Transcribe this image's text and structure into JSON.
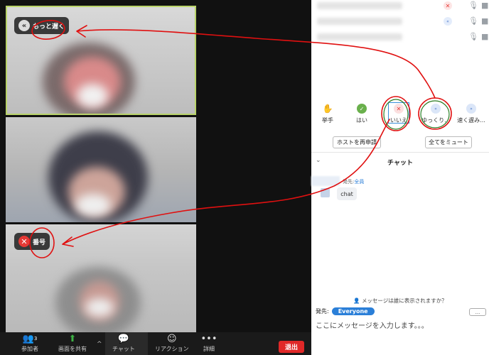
{
  "videos": {
    "tile1_badge": {
      "icon": "double-chevron-left-icon",
      "label": "もっと遅く"
    },
    "tile3_badge": {
      "icon": "close-icon",
      "label": "番号"
    }
  },
  "toolbar": {
    "participants": {
      "label": "参加者",
      "count": "3"
    },
    "share": {
      "label": "画面を共有"
    },
    "chat": {
      "label": "チャット"
    },
    "reaction": {
      "label": "リアクション"
    },
    "more": {
      "label": "詳細"
    },
    "end": {
      "label": "退出"
    }
  },
  "reactions": [
    {
      "label": "挙手",
      "icon": "hand-icon"
    },
    {
      "label": "はい",
      "icon": "check-icon"
    },
    {
      "label": "いいえ",
      "icon": "close-icon"
    },
    {
      "label": "ゆっくり...",
      "icon": "slow-icon"
    },
    {
      "label": "速く遅み...",
      "icon": "fast-icon"
    }
  ],
  "host_buttons": {
    "unmute_request": "ホストを再申請",
    "mute_all": "全てをミュート"
  },
  "chat": {
    "title": "チャット",
    "message": {
      "to_prefix": "発先:",
      "to_target": "全員",
      "text": "chat"
    },
    "who_sees": "メッセージは誰に表示されますか？",
    "to_label": "発先:",
    "to_value": "Everyone",
    "more": "...",
    "input_placeholder": "ここにメッセージを入力します。。。"
  },
  "colors": {
    "end_button": "#e02828",
    "accent_blue": "#2b7fd8",
    "active_border": "#b9d36a",
    "annotation_red": "#e01010"
  }
}
